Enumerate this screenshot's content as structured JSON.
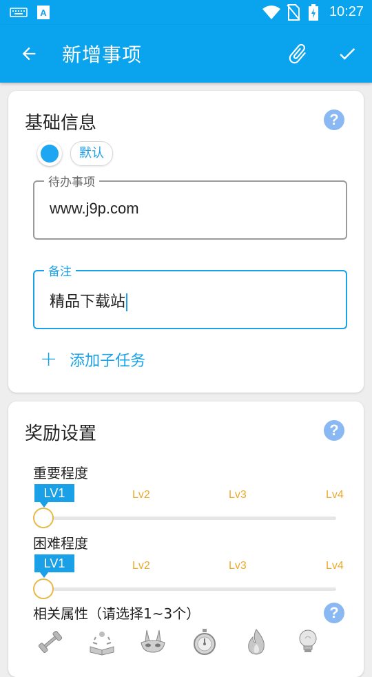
{
  "status_bar": {
    "time": "10:27",
    "colors": {
      "bar": "#0aa3ee"
    }
  },
  "app_bar": {
    "title": "新增事项",
    "icons": [
      "back-arrow-icon",
      "paperclip-icon",
      "checkmark-icon"
    ]
  },
  "basic_info": {
    "title": "基础信息",
    "help_symbol": "?",
    "category_chip": "默认",
    "todo_field": {
      "label": "待办事项",
      "value": "www.j9p.com"
    },
    "note_field": {
      "label": "备注",
      "value": "精品下载站"
    },
    "add_subtask_label": "添加子任务",
    "add_subtask_symbol": "+"
  },
  "reward_settings": {
    "title": "奖励设置",
    "help_symbol": "?",
    "importance": {
      "label": "重要程度",
      "selected": "LV1",
      "levels": [
        "Lv2",
        "Lv3",
        "Lv4"
      ],
      "value": 1
    },
    "difficulty": {
      "label": "困难程度",
      "selected": "LV1",
      "levels": [
        "Lv2",
        "Lv3",
        "Lv4"
      ],
      "value": 1
    },
    "attributes_label": "相关属性（请选择1~3个）",
    "attributes_help_symbol": "?",
    "attribute_icons": [
      "dumbbell-icon",
      "book-sparkle-icon",
      "mask-icon",
      "stopwatch-icon",
      "flame-icon",
      "lightbulb-icon"
    ]
  },
  "colors": {
    "accent": "#1aa0e6",
    "level_tick": "#eda927",
    "help": "#8ab8f2"
  }
}
